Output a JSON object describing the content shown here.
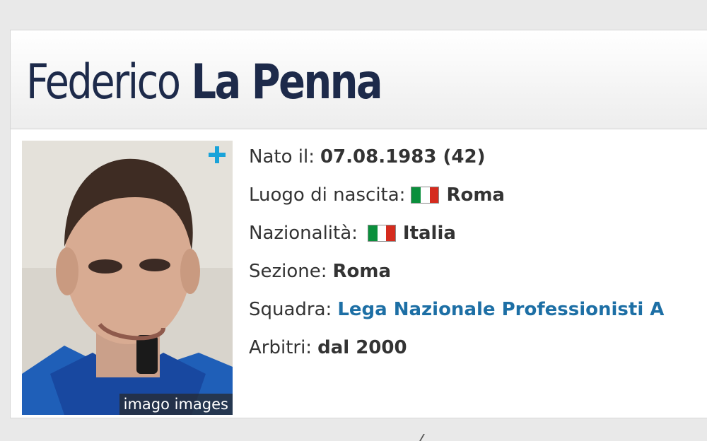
{
  "profile": {
    "first_name": "Federico",
    "last_name": "La Penna",
    "photo_credit": "imago images",
    "colors": {
      "title": "#1d2a4a",
      "link": "#1d6fa5",
      "accent": "#1aa3d9"
    }
  },
  "details": {
    "born_label": "Nato il:",
    "born_value": "07.08.1983 (42)",
    "birthplace_label": "Luogo di nascita:",
    "birthplace_value": "Roma",
    "nationality_label": "Nazionalità:",
    "nationality_value": "Italia",
    "section_label": "Sezione:",
    "section_value": "Roma",
    "team_label": "Squadra:",
    "team_value": "Lega Nazionale Professionisti A",
    "referee_label": "Arbitri:",
    "referee_value": "dal 2000"
  },
  "icons": {
    "expand": "plus-icon",
    "flag": "italy-flag-icon"
  }
}
